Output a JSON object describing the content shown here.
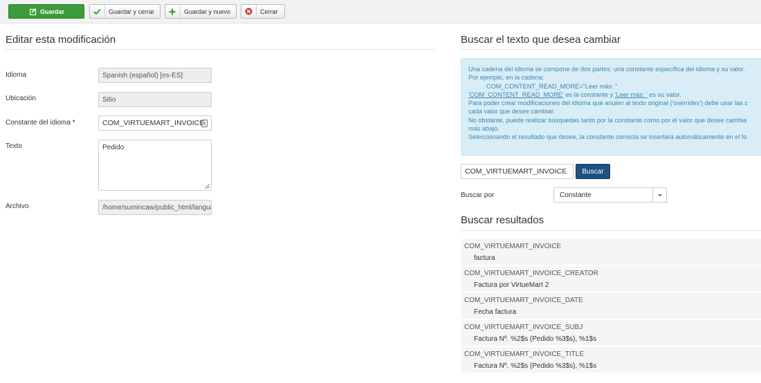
{
  "toolbar": {
    "save": "Guardar",
    "save_close": "Guardar y cerrar",
    "save_new": "Guardar y nuevo",
    "close": "Cerrar"
  },
  "left": {
    "title": "Editar esta modificación",
    "language_label": "Idioma",
    "language_value": "Spanish (español) [es-ES]",
    "location_label": "Ubicación",
    "location_value": "Sitio",
    "constant_label": "Constante del idioma *",
    "constant_value": "COM_VIRTUEMART_INVOICE",
    "text_label": "Texto",
    "text_value": "Pedido",
    "file_label": "Archivo",
    "file_value": "/home/sumincaw/public_html/langua"
  },
  "right": {
    "title": "Buscar el texto que desea cambiar",
    "info": {
      "line1": "Una cadena del idioma se compone de dos partes: una constante específica del idioma y su valor.",
      "line2": "Por ejemplo, en la cadena:",
      "line3": "COM_CONTENT_READ_MORE=\"Leer más: \"",
      "line4_a": "'COM_CONTENT_READ_MORE'",
      "line4_b": " es la constante y ",
      "line4_c": "'Leer más: '",
      "line4_d": " es su valor.",
      "line5": "Para poder crear modificaciones del idioma que anulen al texto original ('overrides') debe usar las c",
      "line6": "cada valor que desee cambiar.",
      "line7": "No obstante, puede realizar búsquedas tanto por la constante como por el valor que desee cambia",
      "line8": "más abajo.",
      "line9": "Seleccionando el resultado que desee, la constante correcta se insertará automáticamente en el fo"
    },
    "search_value": "COM_VIRTUEMART_INVOICE",
    "search_button": "Buscar",
    "search_by_label": "Buscar por",
    "search_by_value": "Constante",
    "results_title": "Buscar resultados",
    "results": [
      {
        "key": "COM_VIRTUEMART_INVOICE",
        "value": "factura"
      },
      {
        "key": "COM_VIRTUEMART_INVOICE_CREATOR",
        "value": "Factura por VirtueMart 2"
      },
      {
        "key": "COM_VIRTUEMART_INVOICE_DATE",
        "value": "Fecha factura"
      },
      {
        "key": "COM_VIRTUEMART_INVOICE_SUBJ",
        "value": "Factura Nº. %2$s (Pedido %3$s), %1$s"
      },
      {
        "key": "COM_VIRTUEMART_INVOICE_TITLE",
        "value": "Factura Nº. %2$s (Pedido %3$s), %1$s"
      }
    ]
  },
  "colors": {
    "save_green": "#3c9b3c",
    "search_blue": "#205081",
    "info_bg": "#d9edf7",
    "info_text": "#3a87ad"
  },
  "icons": {
    "save": "edit-icon",
    "save_close": "check-icon",
    "save_new": "plus-icon",
    "close": "cancel-icon",
    "constant_picker": "list-icon"
  }
}
